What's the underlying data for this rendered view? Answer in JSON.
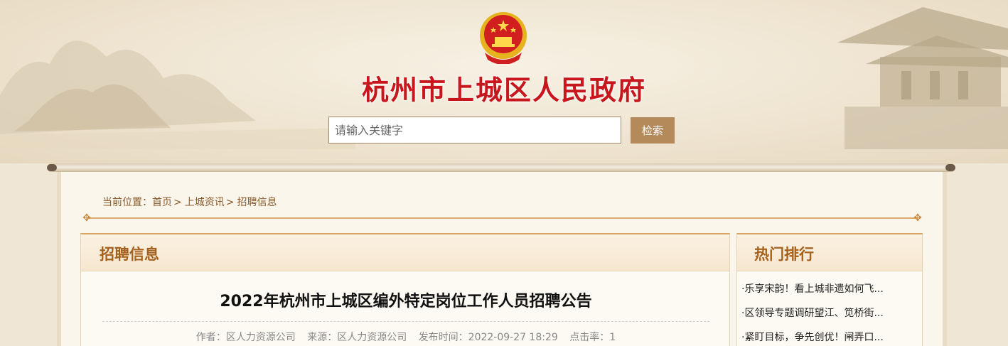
{
  "header": {
    "site_title": "杭州市上城区人民政府",
    "emblem_icon": "national-emblem-icon"
  },
  "search": {
    "placeholder": "请输入关键字",
    "button_label": "检索"
  },
  "breadcrumb": {
    "prefix": "当前位置：",
    "items": [
      "首页",
      "上城资讯",
      "招聘信息"
    ],
    "separator": ">"
  },
  "main": {
    "section_title": "招聘信息",
    "article_title": "2022年杭州市上城区编外特定岗位工作人员招聘公告",
    "meta": {
      "author": "作者：区人力资源公司",
      "source": "来源：区人力资源公司",
      "published": "发布时间：2022-09-27 18:29",
      "hits": "点击率：1"
    }
  },
  "sidebar": {
    "title": "热门排行",
    "items": [
      "·乐享宋韵！看上城非遗如何飞...",
      "·区领导专题调研望江、笕桥街...",
      "·紧盯目标，争先创优！闸弄口..."
    ]
  },
  "colors": {
    "title_red": "#c8161d",
    "accent_brown": "#b48a5a",
    "section_heading": "#a4611d"
  }
}
